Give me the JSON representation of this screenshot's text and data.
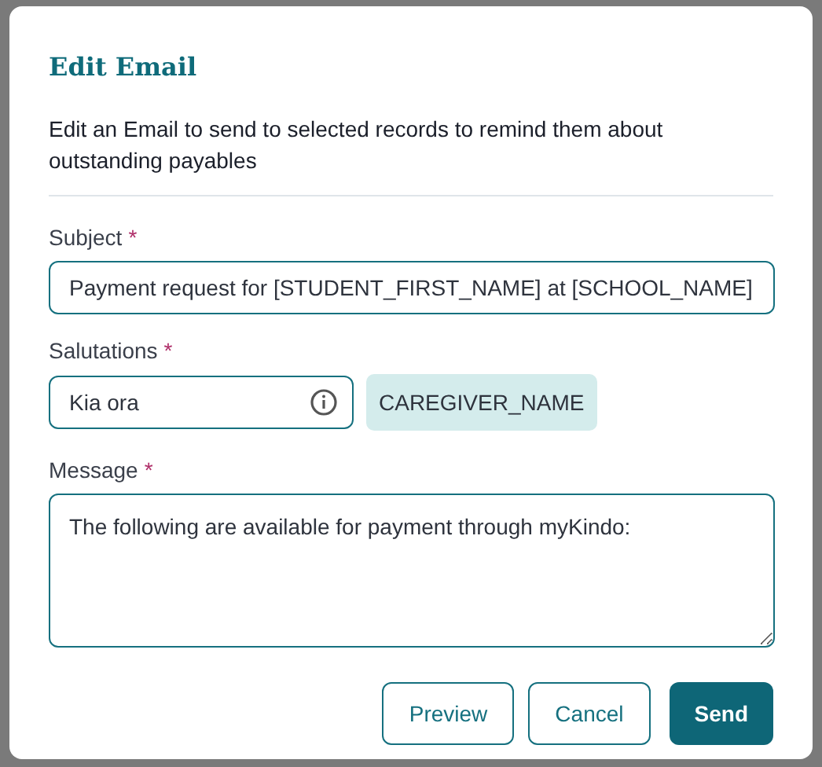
{
  "dialog": {
    "title": "Edit Email",
    "description": "Edit an Email to send to selected records to remind them about outstanding payables"
  },
  "subject": {
    "label": "Subject",
    "required_mark": "*",
    "value": "Payment request for [STUDENT_FIRST_NAME] at [SCHOOL_NAME]"
  },
  "salutations": {
    "label": "Salutations",
    "required_mark": "*",
    "value": "Kia ora",
    "tag": "CAREGIVER_NAME"
  },
  "message": {
    "label": "Message",
    "required_mark": "*",
    "value": "The following are available for payment through myKindo:"
  },
  "buttons": [
    {
      "label": "Preview",
      "kind": "secondary"
    },
    {
      "label": "Cancel",
      "kind": "secondary"
    },
    {
      "label": "Send",
      "kind": "primary"
    }
  ]
}
